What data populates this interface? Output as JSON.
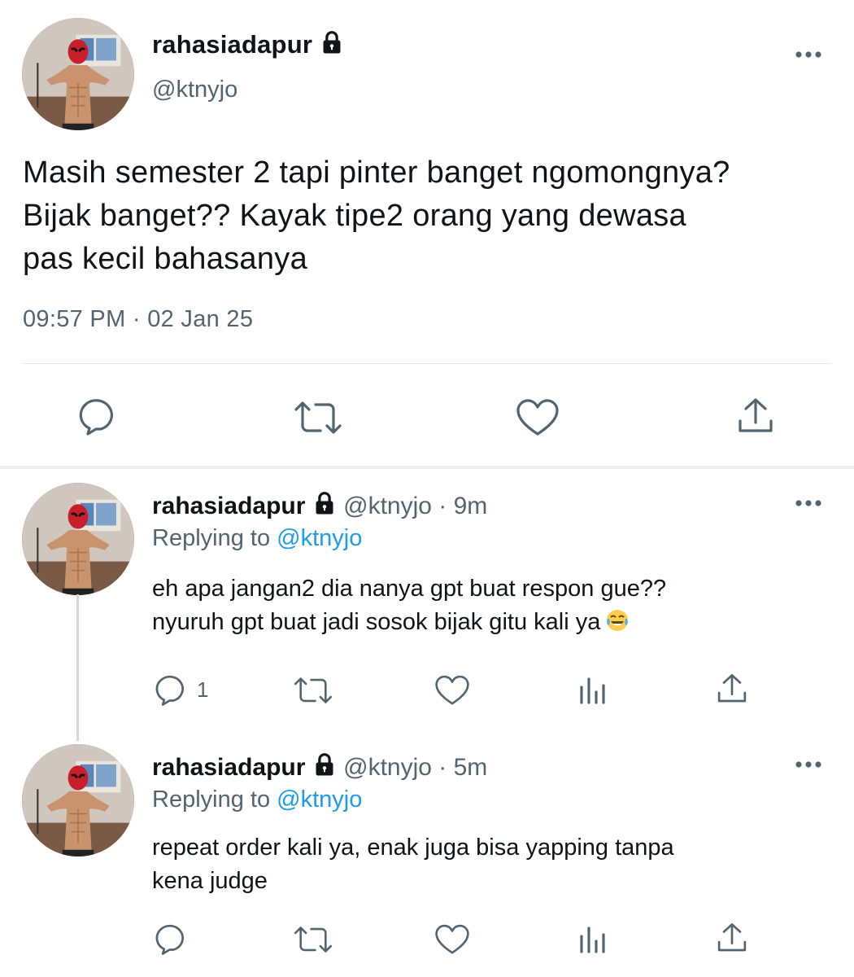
{
  "main_tweet": {
    "display_name": "rahasiadapur",
    "handle": "@ktnyjo",
    "text_lines": [
      "Masih semester 2 tapi pinter banget ngomongnya?",
      "Bijak banget?? Kayak tipe2 orang yang dewasa",
      "pas kecil bahasanya"
    ],
    "timestamp": "09:57 PM · 02 Jan 25",
    "actions": [
      "reply-icon",
      "retweet-icon",
      "like-icon",
      "share-icon"
    ]
  },
  "replies": [
    {
      "display_name": "rahasiadapur",
      "handle_time": "@ktnyjo · 9m",
      "replying_prefix": "Replying to ",
      "replying_to": "@ktnyjo",
      "text_lines": [
        "eh apa jangan2 dia nanya gpt buat respon gue??",
        "nyuruh gpt buat jadi sosok bijak gitu kali ya"
      ],
      "emoji": "face-with-tears-of-joy-icon",
      "reply_count": "1",
      "actions": [
        "reply-icon",
        "retweet-icon",
        "like-icon",
        "views-icon",
        "share-icon"
      ]
    },
    {
      "display_name": "rahasiadapur",
      "handle_time": "@ktnyjo · 5m",
      "replying_prefix": "Replying to ",
      "replying_to": "@ktnyjo",
      "text_lines": [
        "repeat order kali ya, enak juga bisa yapping tanpa",
        "kena judge"
      ],
      "actions": [
        "reply-icon",
        "retweet-icon",
        "like-icon",
        "views-icon",
        "share-icon"
      ]
    }
  ],
  "colors": {
    "text": "#0f1419",
    "secondary": "#536471",
    "link": "#1d9bf0",
    "divider": "#e6e9ec"
  }
}
